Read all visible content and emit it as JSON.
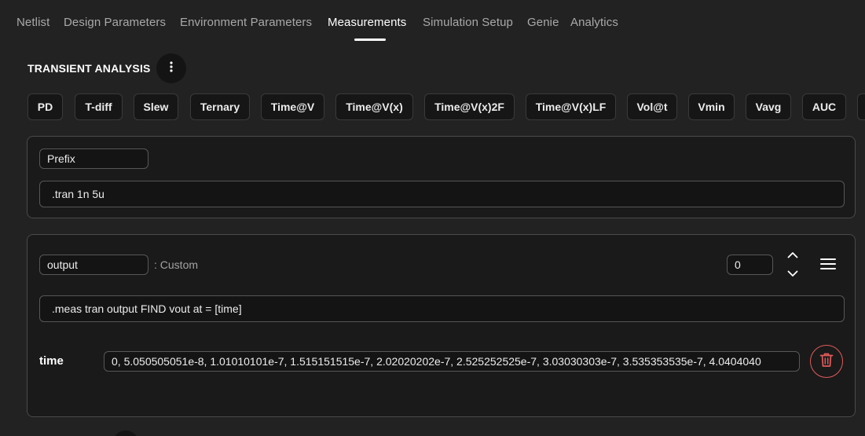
{
  "nav": {
    "tabs": [
      {
        "label": "Netlist"
      },
      {
        "label": "Design Parameters"
      },
      {
        "label": "Environment Parameters"
      },
      {
        "label": "Measurements"
      },
      {
        "label": "Simulation Setup"
      },
      {
        "label": "Genie"
      },
      {
        "label": "Analytics"
      }
    ],
    "active": "Measurements"
  },
  "section": {
    "title": "TRANSIENT ANALYSIS",
    "menu_icon": "kebab-vertical-icon"
  },
  "measure_buttons": [
    {
      "label": "PD"
    },
    {
      "label": "T-diff"
    },
    {
      "label": "Slew"
    },
    {
      "label": "Ternary"
    },
    {
      "label": "Time@V"
    },
    {
      "label": "Time@V(x)"
    },
    {
      "label": "Time@V(x)2F"
    },
    {
      "label": "Time@V(x)LF"
    },
    {
      "label": "Vol@t"
    },
    {
      "label": "Vmin"
    },
    {
      "label": "Vavg"
    },
    {
      "label": "AUC"
    }
  ],
  "prefix_card": {
    "name_value": "Prefix",
    "command_value": ".tran 1n 5u"
  },
  "measure_card": {
    "name_value": "output",
    "type_label": ": Custom",
    "index_value": "0",
    "command_value": ".meas tran output  FIND vout at = [time]",
    "param_label": "time",
    "param_value": "0, 5.050505051e-8, 1.01010101e-7, 1.515151515e-7, 2.02020202e-7, 2.525252525e-7, 3.03030303e-7, 3.535353535e-7, 4.0404040",
    "icons": [
      "chevron-up-icon",
      "chevron-down-icon",
      "hamburger-menu-icon",
      "trash-icon"
    ]
  },
  "colors": {
    "background": "#222222",
    "card": "#1a1a1a",
    "danger": "#e25a5a"
  }
}
